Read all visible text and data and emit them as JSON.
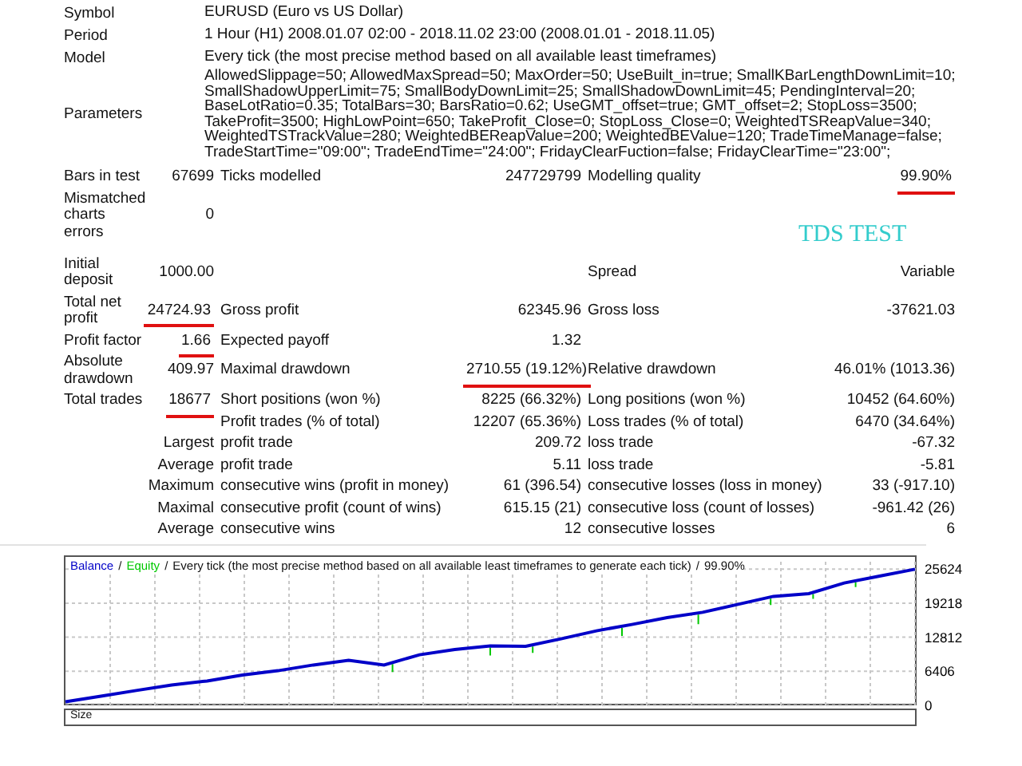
{
  "header": [
    {
      "label": "Symbol",
      "value": "EURUSD (Euro vs US Dollar)"
    },
    {
      "label": "Period",
      "value": "1 Hour (H1) 2008.01.07 02:00 - 2018.11.02 23:00 (2008.01.01 - 2018.11.05)"
    },
    {
      "label": "Model",
      "value": "Every tick (the most precise method based on all available least timeframes)"
    },
    {
      "label": "Parameters",
      "value": "AllowedSlippage=50; AllowedMaxSpread=50; MaxOrder=50; UseBuilt_in=true; SmallKBarLengthDownLimit=10; SmallShadowUpperLimit=75; SmallBodyDownLimit=25; SmallShadowDownLimit=45; PendingInterval=20; BaseLotRatio=0.35; TotalBars=30; BarsRatio=0.62; UseGMT_offset=true; GMT_offset=2; StopLoss=3500; TakeProfit=3500; HighLowPoint=650; TakeProfit_Close=0; StopLoss_Close=0; WeightedTSReapValue=340; WeightedTSTrackValue=280; WeightedBEReapValue=200; WeightedBEValue=120; TradeTimeManage=false; TradeStartTime=\"09:00\"; TradeEndTime=\"24:00\"; FridayClearFuction=false; FridayClearTime=\"23:00\";"
    }
  ],
  "stats": [
    {
      "kind": "main",
      "label": "Bars in test",
      "value": {
        "text": "67699",
        "underlined": false
      },
      "label_2": "Ticks modelled",
      "value_2": {
        "text": "247729799",
        "underlined": false
      },
      "label_3": "Modelling quality",
      "value_3": {
        "text": "99.90%",
        "underlined": true
      }
    },
    {
      "kind": "main",
      "label": "Mismatched charts errors",
      "value": {
        "text": "0",
        "underlined": false
      }
    },
    {
      "kind": "main",
      "label": "Initial deposit",
      "value": {
        "text": "1000.00",
        "underlined": false
      },
      "label_3": "Spread",
      "value_3": {
        "text": "Variable",
        "underlined": false
      }
    },
    {
      "kind": "main",
      "label": "Total net profit",
      "value": {
        "text": "24724.93",
        "underlined": true
      },
      "label_2": "Gross profit",
      "value_2": {
        "text": "62345.96",
        "underlined": false
      },
      "label_3": "Gross loss",
      "value_3": {
        "text": "-37621.03",
        "underlined": false
      }
    },
    {
      "kind": "main",
      "label": "Profit factor",
      "value": {
        "text": "1.66",
        "underlined": true
      },
      "label_2": "Expected payoff",
      "value_2": {
        "text": "1.32",
        "underlined": false
      }
    },
    {
      "kind": "main",
      "label": "Absolute drawdown",
      "value": {
        "text": "409.97",
        "underlined": false
      },
      "label_2": "Maximal drawdown",
      "value_2": {
        "text": "2710.55 (19.12%)",
        "underlined": true
      },
      "label_3": "Relative drawdown",
      "value_3": {
        "text": "46.01% (1013.36)",
        "underlined": false
      }
    },
    {
      "kind": "main",
      "label": "Total trades",
      "value": {
        "text": "18677",
        "underlined": true
      },
      "label_2": "Short positions (won %)",
      "value_2": {
        "text": "8225 (66.32%)",
        "underlined": false
      },
      "label_3": "Long positions (won %)",
      "value_3": {
        "text": "10452 (64.60%)",
        "underlined": false
      }
    },
    {
      "kind": "sub",
      "label_2": "Profit trades (% of total)",
      "value_2": {
        "text": "12207 (65.36%)",
        "underlined": false
      },
      "label_3": "Loss trades (% of total)",
      "value_3": {
        "text": "6470 (34.64%)",
        "underlined": false
      }
    },
    {
      "kind": "sub",
      "label": "Largest",
      "label_2": "profit trade",
      "value_2": {
        "text": "209.72",
        "underlined": false
      },
      "label_3": "loss trade",
      "value_3": {
        "text": "-67.32",
        "underlined": false
      }
    },
    {
      "kind": "sub",
      "label": "Average",
      "label_2": "profit trade",
      "value_2": {
        "text": "5.11",
        "underlined": false
      },
      "label_3": "loss trade",
      "value_3": {
        "text": "-5.81",
        "underlined": false
      }
    },
    {
      "kind": "sub",
      "label": "Maximum",
      "label_2": "consecutive wins (profit in money)",
      "value_2": {
        "text": "61 (396.54)",
        "underlined": false
      },
      "label_3": "consecutive losses (loss in money)",
      "value_3": {
        "text": "33 (-917.10)",
        "underlined": false
      }
    },
    {
      "kind": "sub",
      "label": "Maximal",
      "label_2": "consecutive profit (count of wins)",
      "value_2": {
        "text": "615.15 (21)",
        "underlined": false
      },
      "label_3": "consecutive loss (count of losses)",
      "value_3": {
        "text": "-961.42 (26)",
        "underlined": false
      }
    },
    {
      "kind": "sub",
      "label": "Average",
      "label_2": "consecutive wins",
      "value_2": {
        "text": "12",
        "underlined": false
      },
      "label_3": "consecutive losses",
      "value_3": {
        "text": "6",
        "underlined": false
      }
    }
  ],
  "overlay_label": "TDS TEST",
  "chart": {
    "legend_separator": "/",
    "quality": "99.90%",
    "equity_legend": {
      "name": "Equity",
      "color": "#00c800"
    },
    "chart_data": {
      "type": "line",
      "title": "Every tick (the most precise method based on all available least timeframes to generate each tick)",
      "ylim": [
        0,
        27000
      ],
      "yticks": [
        0,
        6406,
        12812,
        19218,
        25624
      ],
      "grid": true,
      "series": [
        {
          "name": "Balance",
          "color": "#0000c8",
          "values": [
            700,
            1700,
            2800,
            3800,
            4600,
            5700,
            6500,
            7600,
            8500,
            7600,
            9500,
            10500,
            11200,
            11100,
            12500,
            14000,
            15200,
            16500,
            17500,
            19000,
            20500,
            21000,
            23000,
            24300,
            25600
          ]
        }
      ]
    }
  },
  "size_panel": {
    "label": "Size"
  }
}
